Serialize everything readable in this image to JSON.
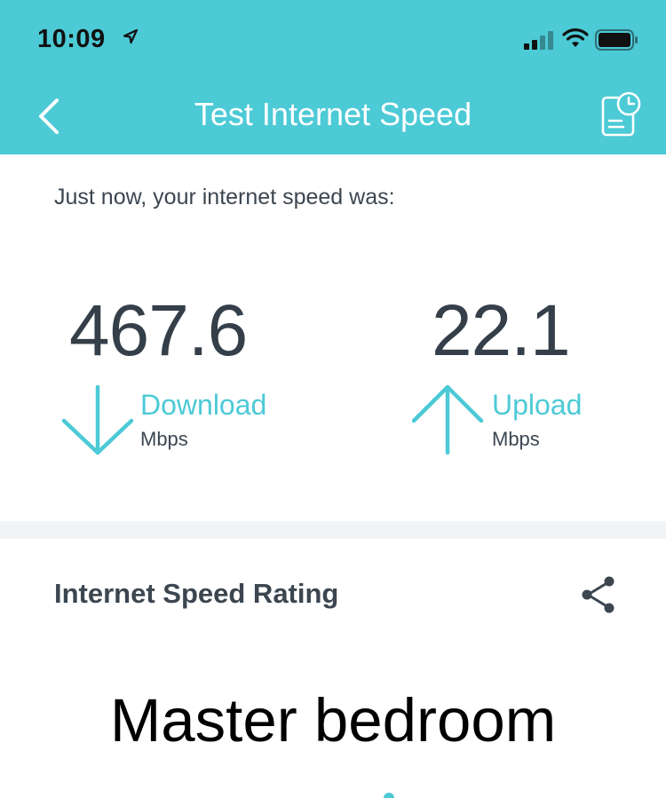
{
  "status_bar": {
    "time": "10:09"
  },
  "nav": {
    "title": "Test Internet Speed"
  },
  "result": {
    "caption": "Just now, your internet speed was:",
    "download": {
      "value": "467.6",
      "label": "Download",
      "unit": "Mbps"
    },
    "upload": {
      "value": "22.1",
      "label": "Upload",
      "unit": "Mbps"
    }
  },
  "rating": {
    "title": "Internet Speed Rating",
    "room": "Master bedroom"
  },
  "colors": {
    "accent": "#4ccad6",
    "text_dark": "#3c4650",
    "divider": "#f2f3f4"
  },
  "icons": {
    "location": "location-arrow-icon",
    "signal": "cellular-signal-icon",
    "wifi": "wifi-icon",
    "battery": "battery-icon",
    "back": "chevron-left-icon",
    "history": "history-report-icon",
    "download": "arrow-down-icon",
    "upload": "arrow-up-icon",
    "share": "share-icon"
  }
}
